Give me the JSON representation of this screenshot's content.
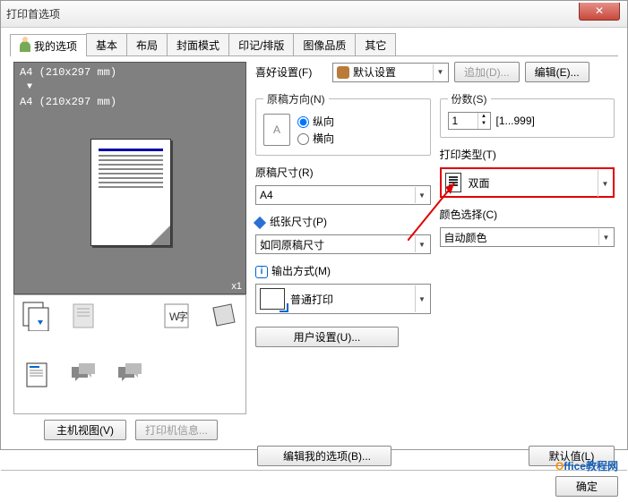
{
  "window": {
    "title": "打印首选项"
  },
  "tabs": [
    "我的选项",
    "基本",
    "布局",
    "封面模式",
    "印记/排版",
    "图像品质",
    "其它"
  ],
  "preview": {
    "size_line1": "A4 (210x297 mm)",
    "size_line2": "A4 (210x297 mm)",
    "count_marker": "x1"
  },
  "left_buttons": {
    "host_view": "主机视图(V)",
    "printer_info": "打印机信息..."
  },
  "favorite": {
    "label": "喜好设置(F)",
    "selected": "默认设置",
    "add": "追加(D)...",
    "edit": "编辑(E)..."
  },
  "orientation": {
    "legend": "原稿方向(N)",
    "icon_letter": "A",
    "portrait": "纵向",
    "landscape": "横向"
  },
  "copies": {
    "legend": "份数(S)",
    "value": "1",
    "range": "[1...999]"
  },
  "original_size": {
    "label": "原稿尺寸(R)",
    "value": "A4"
  },
  "paper_size": {
    "label": "纸张尺寸(P)",
    "value": "如同原稿尺寸"
  },
  "output": {
    "label": "输出方式(M)",
    "value": "普通打印"
  },
  "print_type": {
    "label": "打印类型(T)",
    "value": "双面"
  },
  "color": {
    "label": "颜色选择(C)",
    "value": "自动颜色"
  },
  "user_settings": "用户设置(U)...",
  "edit_my_options": "编辑我的选项(B)...",
  "defaults": "默认值(L)",
  "footer": {
    "ok": "确定",
    "office_brand": "Office",
    "office_sub": "教程网"
  }
}
